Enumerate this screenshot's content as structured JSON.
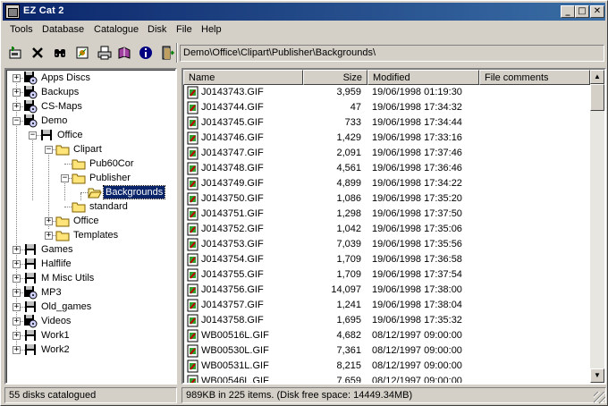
{
  "window": {
    "title": "EZ Cat 2"
  },
  "menu": [
    "Tools",
    "Database",
    "Catalogue",
    "Disk",
    "File",
    "Help"
  ],
  "toolbar": {
    "path": "Demo\\Office\\Clipart\\Publisher\\Backgrounds\\",
    "buttons": [
      "new-catalogue-icon",
      "delete-icon",
      "find-binoculars-icon",
      "properties-icon",
      "print-icon",
      "book-icon",
      "info-icon",
      "exit-icon"
    ]
  },
  "tree": [
    {
      "label": "Apps Discs",
      "level": 0,
      "expander": "+",
      "icon": "cd-drive",
      "row": 0
    },
    {
      "label": "Backups",
      "level": 0,
      "expander": "+",
      "icon": "cd-drive",
      "row": 1
    },
    {
      "label": "CS-Maps",
      "level": 0,
      "expander": "+",
      "icon": "cd-drive",
      "row": 2
    },
    {
      "label": "Demo",
      "level": 0,
      "expander": "-",
      "icon": "cd-drive",
      "row": 3
    },
    {
      "label": "Office",
      "level": 1,
      "expander": "-",
      "icon": "disk",
      "row": 4
    },
    {
      "label": "Clipart",
      "level": 2,
      "expander": "-",
      "icon": "folder",
      "row": 5
    },
    {
      "label": "Pub60Cor",
      "level": 3,
      "expander": "",
      "icon": "folder",
      "row": 6
    },
    {
      "label": "Publisher",
      "level": 3,
      "expander": "-",
      "icon": "folder",
      "row": 7
    },
    {
      "label": "Backgrounds",
      "level": 4,
      "expander": "",
      "icon": "folder-open",
      "row": 8,
      "selected": true
    },
    {
      "label": "standard",
      "level": 3,
      "expander": "",
      "icon": "folder",
      "row": 9
    },
    {
      "label": "Office",
      "level": 2,
      "expander": "+",
      "icon": "folder",
      "row": 10
    },
    {
      "label": "Templates",
      "level": 2,
      "expander": "+",
      "icon": "folder",
      "row": 11
    },
    {
      "label": "Games",
      "level": 0,
      "expander": "+",
      "icon": "disk",
      "row": 12
    },
    {
      "label": "Halflife",
      "level": 0,
      "expander": "+",
      "icon": "disk",
      "row": 13
    },
    {
      "label": "M Misc Utils",
      "level": 0,
      "expander": "+",
      "icon": "disk",
      "row": 14
    },
    {
      "label": "MP3",
      "level": 0,
      "expander": "+",
      "icon": "cd-drive",
      "row": 15
    },
    {
      "label": "Old_games",
      "level": 0,
      "expander": "+",
      "icon": "disk",
      "row": 16
    },
    {
      "label": "Videos",
      "level": 0,
      "expander": "+",
      "icon": "cd-drive",
      "row": 17
    },
    {
      "label": "Work1",
      "level": 0,
      "expander": "+",
      "icon": "disk",
      "row": 18
    },
    {
      "label": "Work2",
      "level": 0,
      "expander": "+",
      "icon": "disk",
      "row": 19
    }
  ],
  "list": {
    "columns": [
      "Name",
      "Size",
      "Modified",
      "File comments"
    ],
    "rows": [
      [
        "J0143743.GIF",
        "3,959",
        "19/06/1998 01:19:30"
      ],
      [
        "J0143744.GIF",
        "47",
        "19/06/1998 17:34:32"
      ],
      [
        "J0143745.GIF",
        "733",
        "19/06/1998 17:34:44"
      ],
      [
        "J0143746.GIF",
        "1,429",
        "19/06/1998 17:33:16"
      ],
      [
        "J0143747.GIF",
        "2,091",
        "19/06/1998 17:37:46"
      ],
      [
        "J0143748.GIF",
        "4,561",
        "19/06/1998 17:36:46"
      ],
      [
        "J0143749.GIF",
        "4,899",
        "19/06/1998 17:34:22"
      ],
      [
        "J0143750.GIF",
        "1,086",
        "19/06/1998 17:35:20"
      ],
      [
        "J0143751.GIF",
        "1,298",
        "19/06/1998 17:37:50"
      ],
      [
        "J0143752.GIF",
        "1,042",
        "19/06/1998 17:35:06"
      ],
      [
        "J0143753.GIF",
        "7,039",
        "19/06/1998 17:35:56"
      ],
      [
        "J0143754.GIF",
        "1,709",
        "19/06/1998 17:36:58"
      ],
      [
        "J0143755.GIF",
        "1,709",
        "19/06/1998 17:37:54"
      ],
      [
        "J0143756.GIF",
        "14,097",
        "19/06/1998 17:38:00"
      ],
      [
        "J0143757.GIF",
        "1,241",
        "19/06/1998 17:38:04"
      ],
      [
        "J0143758.GIF",
        "1,695",
        "19/06/1998 17:35:32"
      ],
      [
        "WB00516L.GIF",
        "4,682",
        "08/12/1997 09:00:00"
      ],
      [
        "WB00530L.GIF",
        "7,361",
        "08/12/1997 09:00:00"
      ],
      [
        "WB00531L.GIF",
        "8,215",
        "08/12/1997 09:00:00"
      ],
      [
        "WB00546L.GIF",
        "7,659",
        "08/12/1997 09:00:00"
      ]
    ]
  },
  "status": {
    "left": "55 disks catalogued",
    "right": "989KB in 225 items. (Disk free space: 14449.34MB)"
  },
  "colors": {
    "titlebar": "#0a246a",
    "selection": "#0a246a",
    "face": "#d4d0c8",
    "folder": "#ffe47a"
  }
}
